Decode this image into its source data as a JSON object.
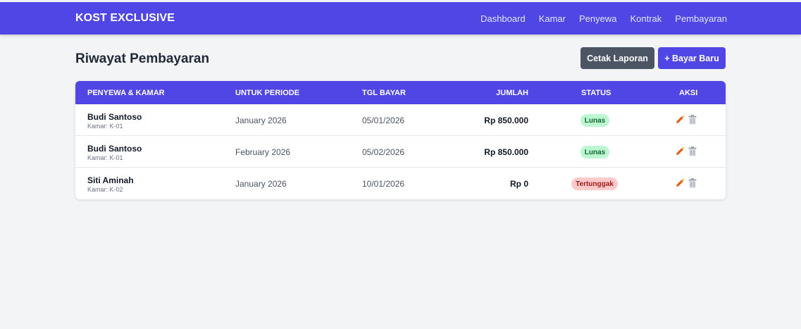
{
  "navbar": {
    "brand": "KOST EXCLUSIVE",
    "links": [
      "Dashboard",
      "Kamar",
      "Penyewa",
      "Kontrak",
      "Pembayaran"
    ]
  },
  "page": {
    "title": "Riwayat Pembayaran",
    "print_button": "Cetak Laporan",
    "new_button": "+ Bayar Baru"
  },
  "table": {
    "headers": [
      "PENYEWA & KAMAR",
      "UNTUK PERIODE",
      "TGL BAYAR",
      "JUMLAH",
      "STATUS",
      "AKSI"
    ],
    "rows": [
      {
        "name": "Budi Santoso",
        "room": "Kamar: K-01",
        "period": "January 2026",
        "date": "05/01/2026",
        "amount": "Rp 850.000",
        "status": "Lunas"
      },
      {
        "name": "Budi Santoso",
        "room": "Kamar: K-01",
        "period": "February 2026",
        "date": "05/02/2026",
        "amount": "Rp 850.000",
        "status": "Lunas"
      },
      {
        "name": "Siti Aminah",
        "room": "Kamar: K-02",
        "period": "January 2026",
        "date": "10/01/2026",
        "amount": "Rp 0",
        "status": "Tertunggak"
      }
    ]
  },
  "icons": {
    "edit": "pencil-icon",
    "delete": "trash-icon"
  },
  "colors": {
    "primary": "#4f46e5",
    "print_button": "#4b5563",
    "paid_bg": "#bbf7d0",
    "paid_text": "#166534",
    "due_bg": "#fecaca",
    "due_text": "#991b1b",
    "edit_icon": "#ea580c",
    "delete_icon": "#9ca3af"
  }
}
